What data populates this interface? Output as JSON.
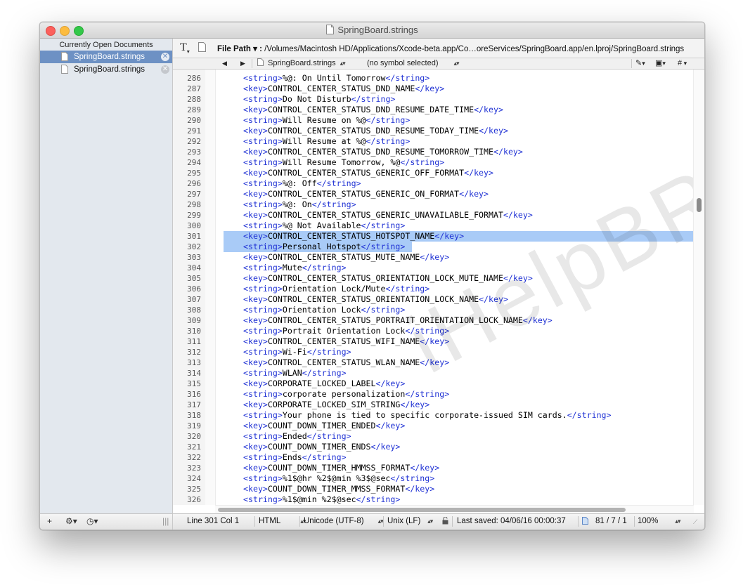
{
  "window": {
    "title": "SpringBoard.strings"
  },
  "sidebar": {
    "header": "Currently Open Documents",
    "documents": [
      {
        "name": "SpringBoard.strings",
        "selected": true
      },
      {
        "name": "SpringBoard.strings",
        "selected": false
      }
    ],
    "footer": {
      "add": "+",
      "gear": "⚙︎▾",
      "history": "◷▾",
      "grip": "|||"
    }
  },
  "toolbar": {
    "text_tool": "T",
    "file_path_label": "File Path ▾ :",
    "file_path_value": "/Volumes/Macintosh HD/Applications/Xcode-beta.app/Co…oreServices/SpringBoard.app/en.lproj/SpringBoard.strings"
  },
  "navbar": {
    "back": "◀",
    "forward": "▶",
    "file": "SpringBoard.strings",
    "symbol": "(no symbol selected)",
    "pen": "✎",
    "doc": "▣",
    "hash": "#"
  },
  "editor": {
    "selected_lines": [
      301,
      302
    ],
    "lines": [
      {
        "n": "286",
        "o": "<string>",
        "t": "%@: On Until Tomorrow",
        "c": "</string>"
      },
      {
        "n": "287",
        "o": "<key>",
        "t": "CONTROL_CENTER_STATUS_DND_NAME",
        "c": "</key>"
      },
      {
        "n": "288",
        "o": "<string>",
        "t": "Do Not Disturb",
        "c": "</string>"
      },
      {
        "n": "289",
        "o": "<key>",
        "t": "CONTROL_CENTER_STATUS_DND_RESUME_DATE_TIME",
        "c": "</key>"
      },
      {
        "n": "290",
        "o": "<string>",
        "t": "Will Resume on %@",
        "c": "</string>"
      },
      {
        "n": "291",
        "o": "<key>",
        "t": "CONTROL_CENTER_STATUS_DND_RESUME_TODAY_TIME",
        "c": "</key>"
      },
      {
        "n": "292",
        "o": "<string>",
        "t": "Will Resume at %@",
        "c": "</string>"
      },
      {
        "n": "293",
        "o": "<key>",
        "t": "CONTROL_CENTER_STATUS_DND_RESUME_TOMORROW_TIME",
        "c": "</key>"
      },
      {
        "n": "294",
        "o": "<string>",
        "t": "Will Resume Tomorrow, %@",
        "c": "</string>"
      },
      {
        "n": "295",
        "o": "<key>",
        "t": "CONTROL_CENTER_STATUS_GENERIC_OFF_FORMAT",
        "c": "</key>"
      },
      {
        "n": "296",
        "o": "<string>",
        "t": "%@: Off",
        "c": "</string>"
      },
      {
        "n": "297",
        "o": "<key>",
        "t": "CONTROL_CENTER_STATUS_GENERIC_ON_FORMAT",
        "c": "</key>"
      },
      {
        "n": "298",
        "o": "<string>",
        "t": "%@: On",
        "c": "</string>"
      },
      {
        "n": "299",
        "o": "<key>",
        "t": "CONTROL_CENTER_STATUS_GENERIC_UNAVAILABLE_FORMAT",
        "c": "</key>"
      },
      {
        "n": "300",
        "o": "<string>",
        "t": "%@ Not Available",
        "c": "</string>"
      },
      {
        "n": "301",
        "o": "<key>",
        "t": "CONTROL_CENTER_STATUS_HOTSPOT_NAME",
        "c": "</key>"
      },
      {
        "n": "302",
        "o": "<string>",
        "t": "Personal Hotspot",
        "c": "</string>"
      },
      {
        "n": "303",
        "o": "<key>",
        "t": "CONTROL_CENTER_STATUS_MUTE_NAME",
        "c": "</key>"
      },
      {
        "n": "304",
        "o": "<string>",
        "t": "Mute",
        "c": "</string>"
      },
      {
        "n": "305",
        "o": "<key>",
        "t": "CONTROL_CENTER_STATUS_ORIENTATION_LOCK_MUTE_NAME",
        "c": "</key>"
      },
      {
        "n": "306",
        "o": "<string>",
        "t": "Orientation Lock/Mute",
        "c": "</string>"
      },
      {
        "n": "307",
        "o": "<key>",
        "t": "CONTROL_CENTER_STATUS_ORIENTATION_LOCK_NAME",
        "c": "</key>"
      },
      {
        "n": "308",
        "o": "<string>",
        "t": "Orientation Lock",
        "c": "</string>"
      },
      {
        "n": "309",
        "o": "<key>",
        "t": "CONTROL_CENTER_STATUS_PORTRAIT_ORIENTATION_LOCK_NAME",
        "c": "</key>"
      },
      {
        "n": "310",
        "o": "<string>",
        "t": "Portrait Orientation Lock",
        "c": "</string>"
      },
      {
        "n": "311",
        "o": "<key>",
        "t": "CONTROL_CENTER_STATUS_WIFI_NAME",
        "c": "</key>"
      },
      {
        "n": "312",
        "o": "<string>",
        "t": "Wi-Fi",
        "c": "</string>"
      },
      {
        "n": "313",
        "o": "<key>",
        "t": "CONTROL_CENTER_STATUS_WLAN_NAME",
        "c": "</key>"
      },
      {
        "n": "314",
        "o": "<string>",
        "t": "WLAN",
        "c": "</string>"
      },
      {
        "n": "315",
        "o": "<key>",
        "t": "CORPORATE_LOCKED_LABEL",
        "c": "</key>"
      },
      {
        "n": "316",
        "o": "<string>",
        "t": "corporate personalization",
        "c": "</string>"
      },
      {
        "n": "317",
        "o": "<key>",
        "t": "CORPORATE_LOCKED_SIM_STRING",
        "c": "</key>"
      },
      {
        "n": "318",
        "o": "<string>",
        "t": "Your phone is tied to specific corporate-issued SIM cards.",
        "c": "</string>"
      },
      {
        "n": "319",
        "o": "<key>",
        "t": "COUNT_DOWN_TIMER_ENDED",
        "c": "</key>"
      },
      {
        "n": "320",
        "o": "<string>",
        "t": "Ended",
        "c": "</string>"
      },
      {
        "n": "321",
        "o": "<key>",
        "t": "COUNT_DOWN_TIMER_ENDS",
        "c": "</key>"
      },
      {
        "n": "322",
        "o": "<string>",
        "t": "Ends",
        "c": "</string>"
      },
      {
        "n": "323",
        "o": "<key>",
        "t": "COUNT_DOWN_TIMER_HMMSS_FORMAT",
        "c": "</key>"
      },
      {
        "n": "324",
        "o": "<string>",
        "t": "%1$@hr %2$@min %3$@sec",
        "c": "</string>"
      },
      {
        "n": "325",
        "o": "<key>",
        "t": "COUNT_DOWN_TIMER_MMSS_FORMAT",
        "c": "</key>"
      },
      {
        "n": "326",
        "o": "<string>",
        "t": "%1$@min %2$@sec",
        "c": "</string>"
      }
    ]
  },
  "watermark": "iHelpBR.com",
  "statusbar": {
    "position": "Line 301 Col 1",
    "syntax": "HTML",
    "encoding": "Unicode (UTF-8)",
    "line_endings": "Unix (LF)",
    "last_saved": "Last saved: 04/06/16 00:00:37",
    "counts": "81 / 7 / 1",
    "zoom": "100%"
  },
  "colors": {
    "tag": "#1f31d4",
    "selection": "#a9cbf7",
    "sidebar_selected": "#6d91c4"
  }
}
